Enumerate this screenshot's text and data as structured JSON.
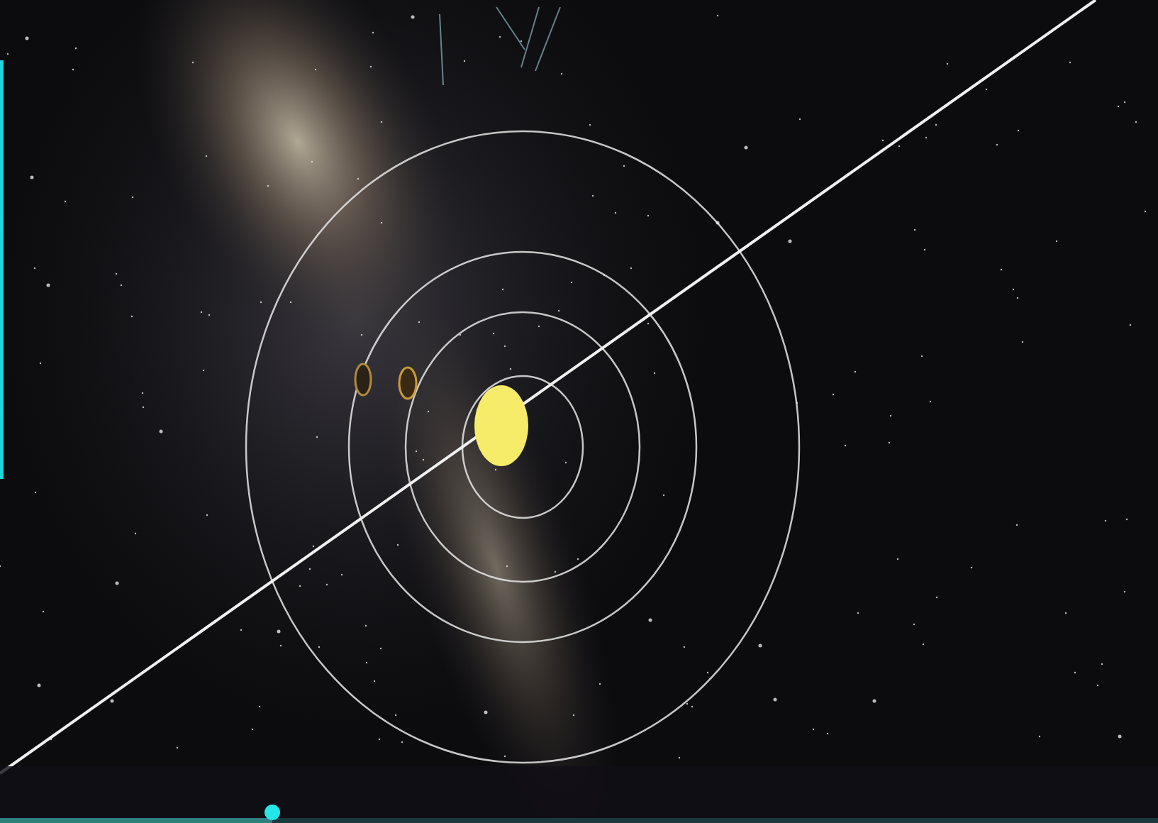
{
  "timeline": {
    "level": 0.235
  }
}
